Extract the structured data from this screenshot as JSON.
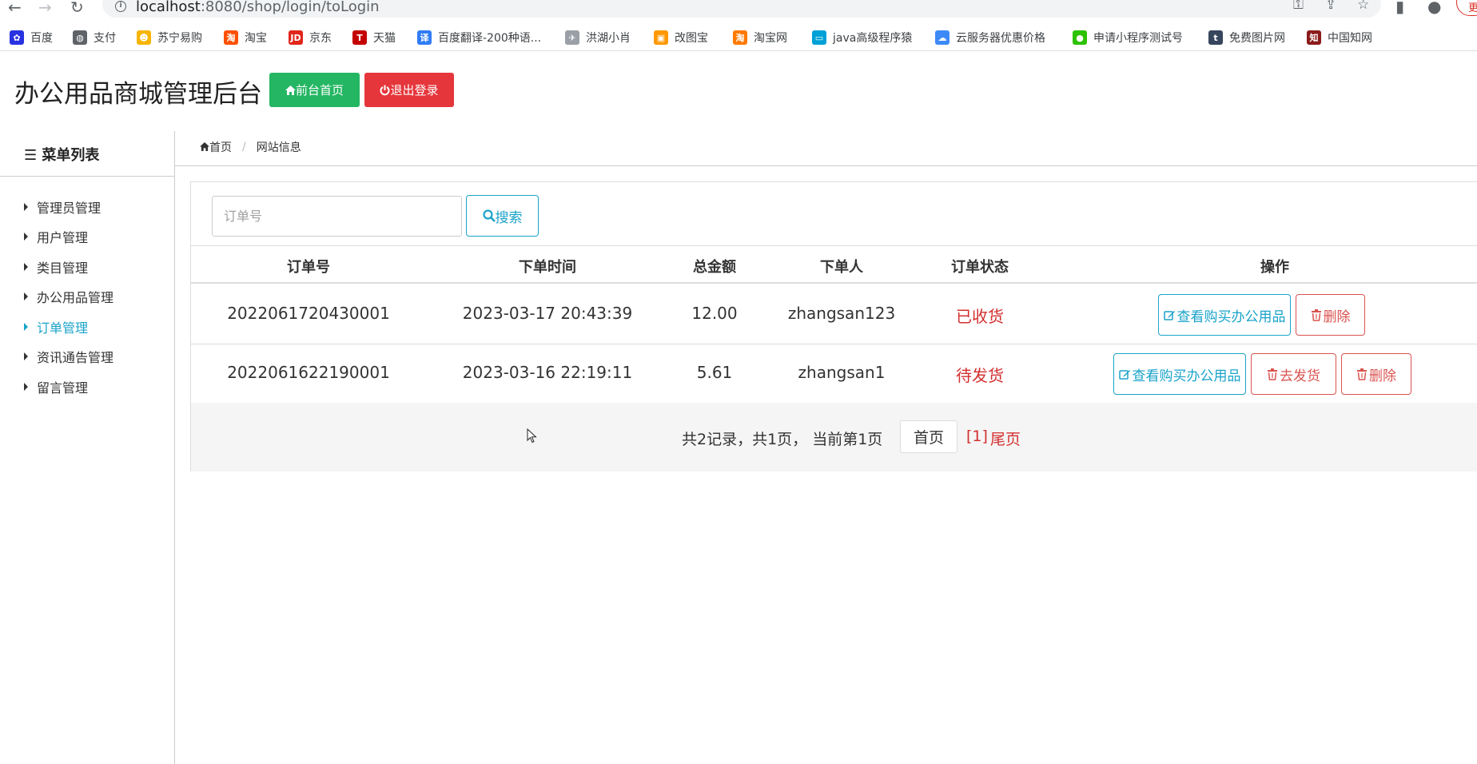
{
  "browser": {
    "url_host": "localhost",
    "url_rest": ":8080/shop/login/toLogin",
    "profile_label": "更"
  },
  "bookmarks": [
    {
      "label": "百度",
      "icon": "baidu-icon",
      "color": "#2932e1",
      "glyph": "✿"
    },
    {
      "label": "支付",
      "icon": "globe-icon",
      "color": "#5f6368",
      "glyph": "◍"
    },
    {
      "label": "苏宁易购",
      "icon": "suning-icon",
      "color": "#f7b500",
      "glyph": "☻"
    },
    {
      "label": "淘宝",
      "icon": "taobao-icon",
      "color": "#ff5000",
      "glyph": "淘"
    },
    {
      "label": "京东",
      "icon": "jd-icon",
      "color": "#e1251b",
      "glyph": "JD"
    },
    {
      "label": "天猫",
      "icon": "tmall-icon",
      "color": "#c40000",
      "glyph": "T"
    },
    {
      "label": "百度翻译-200种语...",
      "icon": "translate-icon",
      "color": "#2f7cf6",
      "glyph": "译"
    },
    {
      "label": "洪湖小肖",
      "icon": "bird-icon",
      "color": "#9aa0a6",
      "glyph": "✈"
    },
    {
      "label": "改图宝",
      "icon": "gaitubao-icon",
      "color": "#ff9800",
      "glyph": "▣"
    },
    {
      "label": "淘宝网",
      "icon": "taobao-net-icon",
      "color": "#ff7a00",
      "glyph": "淘"
    },
    {
      "label": "java高级程序猿",
      "icon": "bilibili-icon",
      "color": "#00a1d6",
      "glyph": "▭"
    },
    {
      "label": "云服务器优惠价格",
      "icon": "cloud-icon",
      "color": "#3d8af7",
      "glyph": "☁"
    },
    {
      "label": "申请小程序测试号",
      "icon": "wechat-icon",
      "color": "#2dc100",
      "glyph": "●"
    },
    {
      "label": "免费图片网",
      "icon": "tumblr-icon",
      "color": "#36465d",
      "glyph": "t"
    },
    {
      "label": "中国知网",
      "icon": "cnki-icon",
      "color": "#8b1a1a",
      "glyph": "知"
    }
  ],
  "header": {
    "title": "办公用品商城管理后台",
    "home_button": "前台首页",
    "logout_button": "退出登录"
  },
  "sidebar": {
    "heading": "菜单列表",
    "items": [
      {
        "label": "管理员管理",
        "active": false
      },
      {
        "label": "用户管理",
        "active": false
      },
      {
        "label": "类目管理",
        "active": false
      },
      {
        "label": "办公用品管理",
        "active": false
      },
      {
        "label": "订单管理",
        "active": true
      },
      {
        "label": "资讯通告管理",
        "active": false
      },
      {
        "label": "留言管理",
        "active": false
      }
    ]
  },
  "breadcrumb": {
    "home": "首页",
    "current": "网站信息"
  },
  "search": {
    "placeholder": "订单号",
    "value": "",
    "button": "搜索"
  },
  "table": {
    "columns": [
      "订单号",
      "下单时间",
      "总金额",
      "下单人",
      "订单状态",
      "操作"
    ],
    "rows": [
      {
        "order_no": "2022061720430001",
        "time": "2023-03-17 20:43:39",
        "amount": "12.00",
        "user": "zhangsan123",
        "status": "已收货",
        "actions": [
          "查看购买办公用品",
          "删除"
        ]
      },
      {
        "order_no": "2022061622190001",
        "time": "2023-03-16 22:19:11",
        "amount": "5.61",
        "user": "zhangsan1",
        "status": "待发货",
        "actions": [
          "查看购买办公用品",
          "去发货",
          "删除"
        ]
      }
    ]
  },
  "pagination": {
    "summary": "共2记录，共1页， 当前第1页",
    "first": "首页",
    "current": "[1]",
    "last": "尾页"
  },
  "colors": {
    "accent": "#1aa3c9",
    "success": "#24b663",
    "danger": "#e5363b",
    "status": "#d32f2f"
  }
}
